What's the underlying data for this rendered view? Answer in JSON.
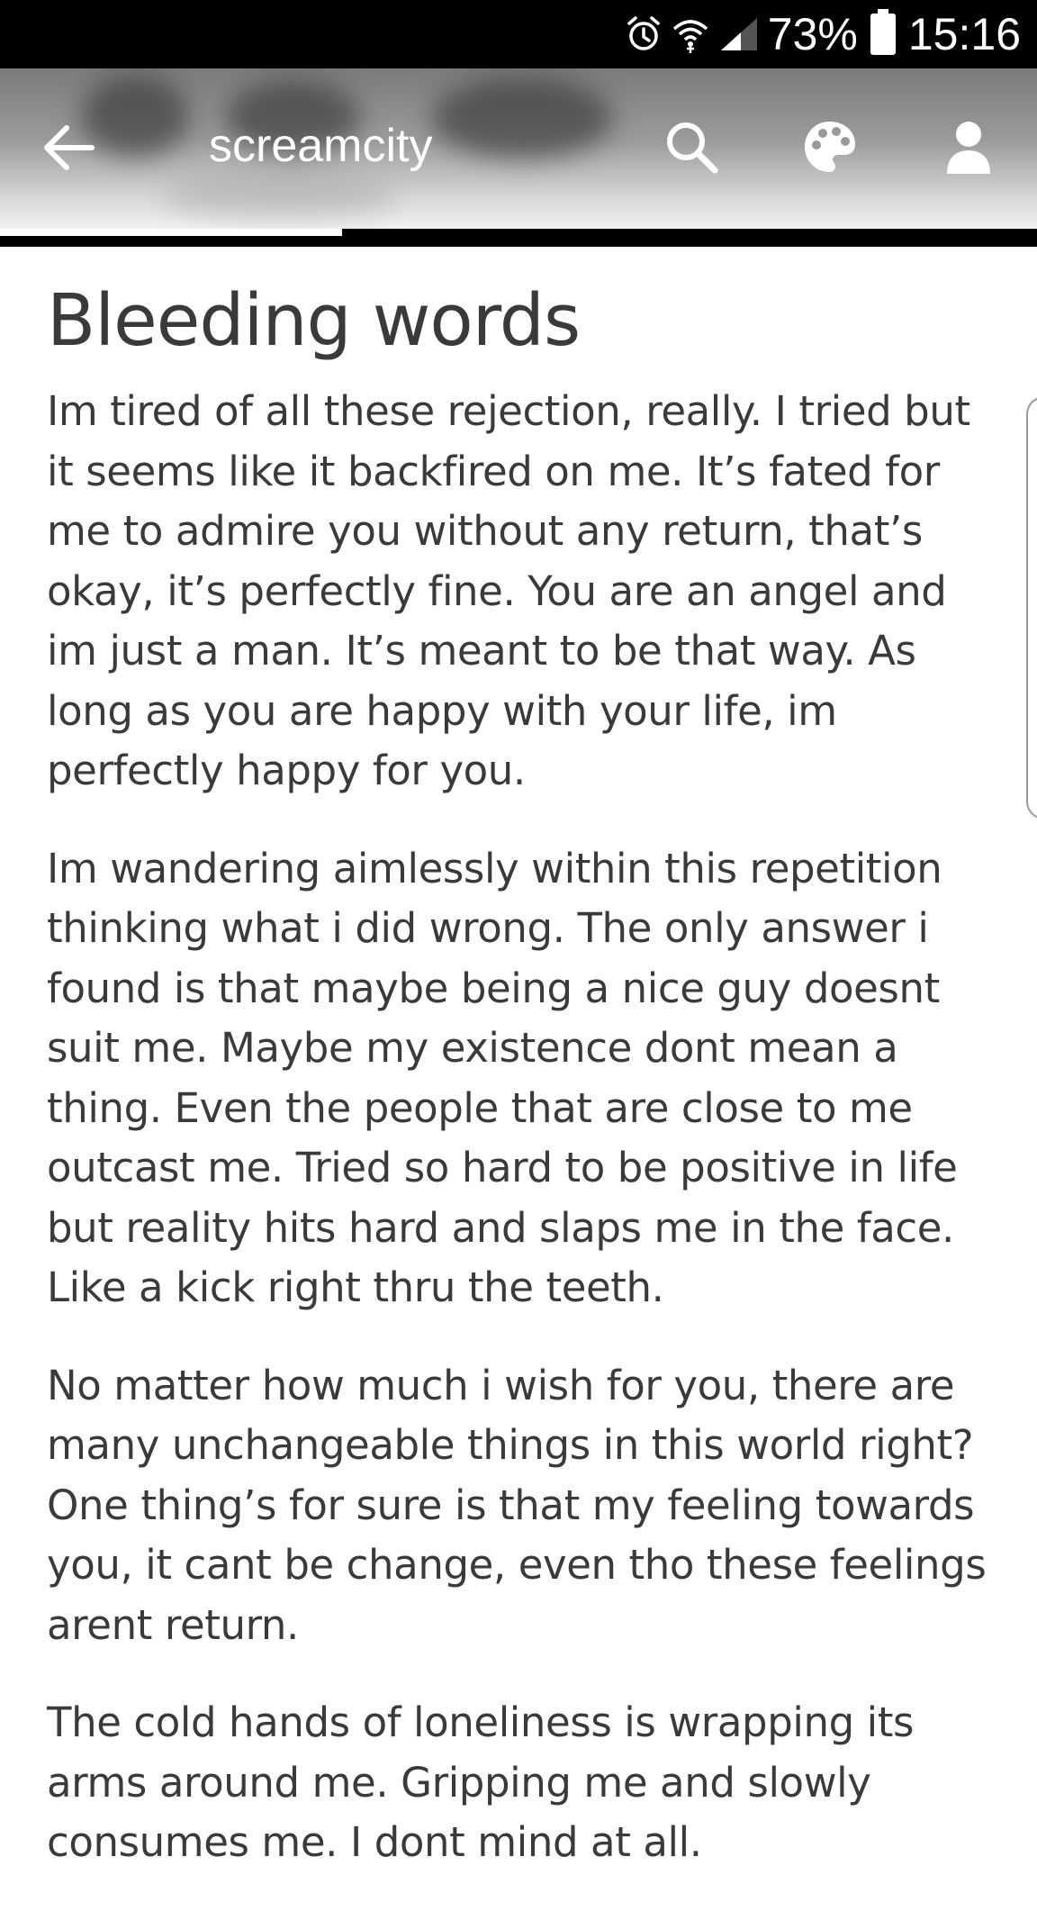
{
  "status_bar": {
    "battery_percent": "73%",
    "time": "15:16",
    "icons": [
      "alarm-icon",
      "wifi-icon",
      "signal-icon",
      "battery-icon"
    ]
  },
  "app_bar": {
    "blog_name": "screamcity",
    "icons": [
      "back-arrow-icon",
      "search-icon",
      "palette-icon",
      "account-icon"
    ]
  },
  "reading_progress": 0.33,
  "post": {
    "title": "Bleeding words",
    "paragraphs": [
      "Im tired of all these rejection, really. I tried but it seems like it backfired on me. It’s fated for me to admire you without any return, that’s okay, it’s perfectly fine. You are an angel and im just a man. It’s meant to be that way. As long as you are happy with your life, im perfectly happy for you.",
      "Im wandering aimlessly within this repetition thinking what i did wrong. The only answer i found is that maybe being a nice guy doesnt suit me. Maybe my existence dont mean a thing. Even the people that are close to me outcast me. Tried so hard to be positive in life but reality hits hard and slaps me in the face. Like a kick right thru the teeth.",
      "No matter how much i wish for you, there are many unchangeable things in this world right? One thing’s for sure is that my feeling towards you, it cant be change, even tho these feelings arent return.",
      "The cold hands of loneliness is wrapping its arms around me. Gripping me and slowly consumes me. I dont mind at all."
    ]
  }
}
